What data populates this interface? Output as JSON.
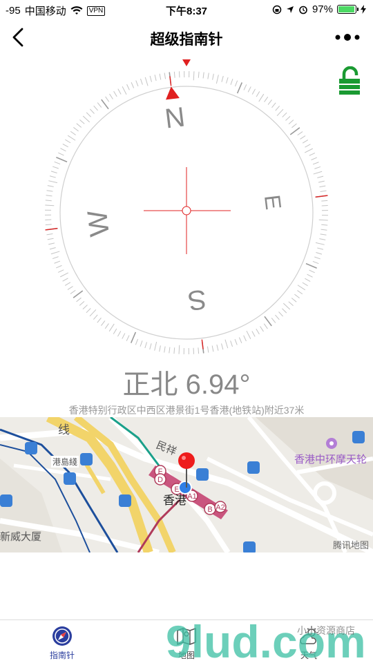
{
  "status_bar": {
    "signal": "-95",
    "carrier": "中国移动",
    "wifi_icon": "wifi-icon",
    "vpn": "VPN",
    "time": "下午8:37",
    "battery_percent": "97%",
    "battery_level": 0.97
  },
  "nav": {
    "title": "超级指南针",
    "back_icon": "chevron-left-icon",
    "more_icon": "more-dots-icon"
  },
  "lock": {
    "icon": "unlock-icon",
    "color": "#1a9a32"
  },
  "compass": {
    "heading_deg": 6.94,
    "labels": {
      "n": "N",
      "e": "E",
      "s": "S",
      "w": "W"
    },
    "accent_color": "#e02020"
  },
  "reading": {
    "heading_text": "正北 6.94°",
    "address": "香港特别行政区中西区港景街1号香港(地铁站)附近37米"
  },
  "map": {
    "labels": {
      "street_1": "线",
      "street_2": "民祥",
      "station_1": "港島綫",
      "landmark": "香港中环摩天轮",
      "place_1": "香港",
      "place_2": "新威大厦",
      "attribution": "腾讯地图"
    },
    "exits": [
      "F",
      "D",
      "E",
      "A1",
      "B",
      "A2"
    ]
  },
  "tabs": [
    {
      "label": "指南针",
      "icon": "compass-icon",
      "active": true
    },
    {
      "label": "地图",
      "icon": "map-icon",
      "active": false
    },
    {
      "label": "天气",
      "icon": "weather-icon",
      "active": false
    }
  ],
  "watermark": {
    "text": "9lud.com",
    "subtext": "小小资源商店"
  }
}
